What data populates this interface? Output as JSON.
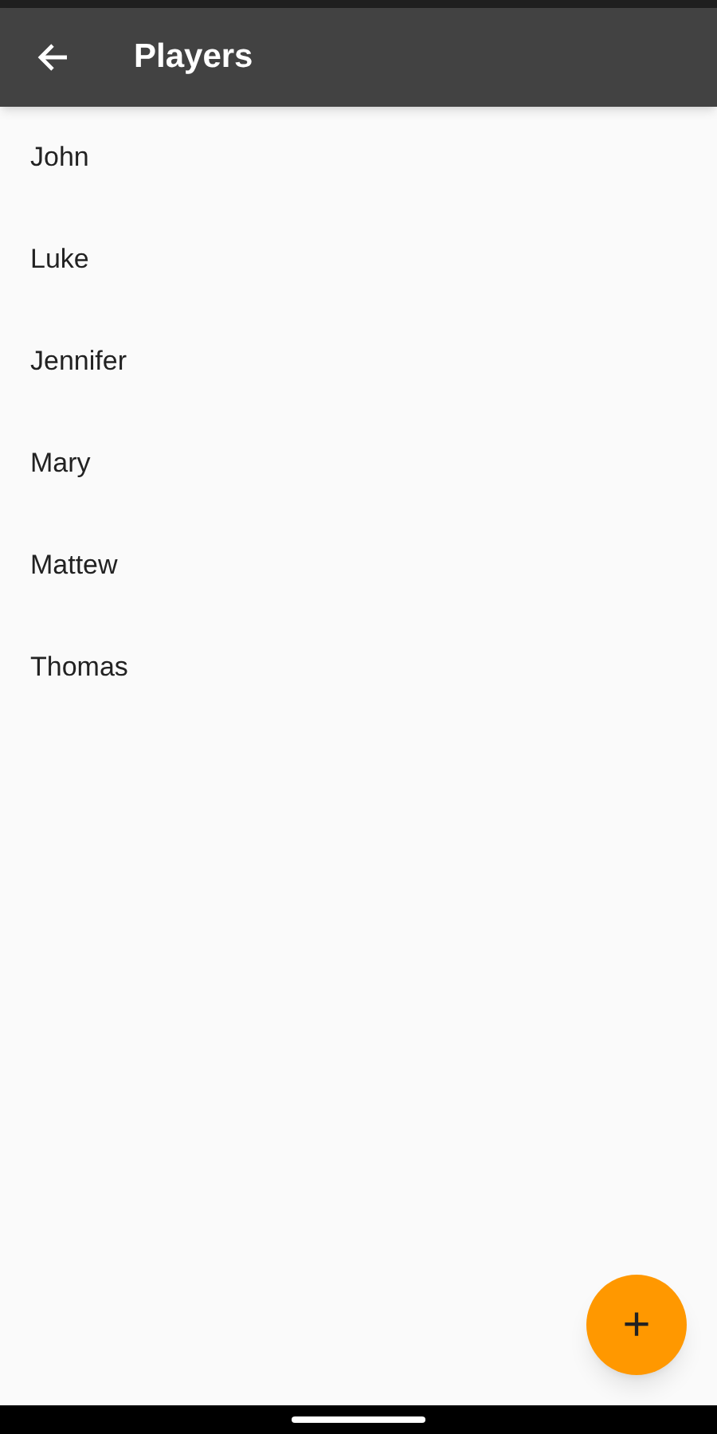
{
  "app_bar": {
    "title": "Players"
  },
  "players": [
    {
      "name": "John"
    },
    {
      "name": "Luke"
    },
    {
      "name": "Jennifer"
    },
    {
      "name": "Mary"
    },
    {
      "name": "Mattew"
    },
    {
      "name": "Thomas"
    }
  ],
  "fab": {
    "label": "+"
  }
}
